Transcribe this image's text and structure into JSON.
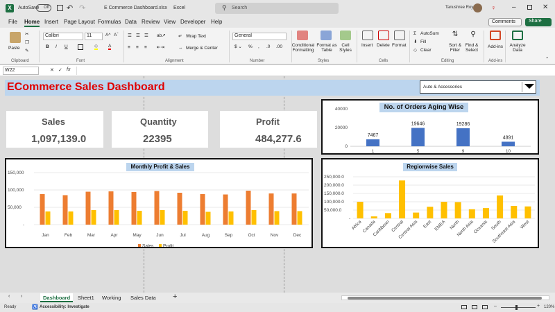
{
  "titlebar": {
    "autosave": "AutoSave",
    "autosave_state": "Off",
    "filename": "E Commerce Dashboard.xlsx",
    "app": "Excel",
    "search_placeholder": "Search",
    "user": "Tanushree Roy"
  },
  "menu": [
    "File",
    "Home",
    "Insert",
    "Page Layout",
    "Formulas",
    "Data",
    "Review",
    "View",
    "Developer",
    "Help"
  ],
  "menu_right": {
    "comments": "Comments",
    "share": "Share"
  },
  "ribbon": {
    "clipboard": {
      "paste": "Paste",
      "label": "Clipboard"
    },
    "font": {
      "name": "Calibri",
      "size": "11",
      "label": "Font"
    },
    "alignment": {
      "wrap": "Wrap Text",
      "merge": "Merge & Center",
      "label": "Alignment"
    },
    "number": {
      "format": "General",
      "label": "Number"
    },
    "styles": {
      "conditional": "Conditional Formatting",
      "table": "Format as Table",
      "cell": "Cell Styles",
      "label": "Styles"
    },
    "cells": {
      "insert": "Insert",
      "delete": "Delete",
      "format": "Format",
      "label": "Cells"
    },
    "editing": {
      "autosum": "AutoSum",
      "fill": "Fill",
      "clear": "Clear",
      "sort": "Sort & Filter",
      "find": "Find & Select",
      "label": "Editing"
    },
    "addins": {
      "addins": "Add-ins",
      "label": "Add-ins"
    },
    "analyze": {
      "label": "Analyze Data"
    }
  },
  "formula": {
    "namebox": "W22",
    "fx": "fx"
  },
  "dashboard": {
    "title": "ECommerce Sales Dashboard",
    "dropdown": "Auto & Accessories",
    "kpis": [
      {
        "label": "Sales",
        "value": "1,097,139.0"
      },
      {
        "label": "Quantity",
        "value": "22395"
      },
      {
        "label": "Profit",
        "value": "484,277.6"
      }
    ]
  },
  "chart_data": [
    {
      "type": "bar",
      "title": "No. of Orders Aging Wise",
      "categories": [
        "1",
        "5",
        "9",
        "10"
      ],
      "values": [
        7467,
        19646,
        19286,
        4891
      ],
      "yticks": [
        "40000",
        "20000",
        "0"
      ],
      "ylim": [
        0,
        40000
      ],
      "color": "#4472c4"
    },
    {
      "type": "bar",
      "title": "Monthly Profit & Sales",
      "categories": [
        "Jan",
        "Feb",
        "Mar",
        "Apr",
        "May",
        "Jun",
        "Jul",
        "Aug",
        "Sep",
        "Oct",
        "Nov",
        "Dec"
      ],
      "series": [
        {
          "name": "Sales",
          "values": [
            88000,
            85000,
            95000,
            96000,
            94000,
            97000,
            92000,
            88000,
            87000,
            98000,
            90000,
            90000
          ],
          "color": "#ed7d31"
        },
        {
          "name": "Profit",
          "values": [
            38000,
            38000,
            42000,
            42000,
            40000,
            42000,
            40000,
            37000,
            38000,
            42000,
            39000,
            39000
          ],
          "color": "#ffc000"
        }
      ],
      "yticks": [
        "150,000",
        "100,000",
        "50,000",
        "-"
      ],
      "ylim": [
        0,
        150000
      ]
    },
    {
      "type": "bar",
      "title": "Regionwise Sales",
      "categories": [
        "Africa",
        "Canada",
        "Caribbean",
        "Central",
        "Central Asia",
        "East",
        "EMEA",
        "North",
        "North Asia",
        "Oceania",
        "South",
        "Southeast Asia",
        "West"
      ],
      "values": [
        100000,
        12000,
        32000,
        228000,
        35000,
        70000,
        100000,
        98000,
        55000,
        62000,
        138000,
        75000,
        72000
      ],
      "yticks": [
        "250,000.0",
        "200,000.0",
        "150,000.0",
        "100,000.0",
        "50,000.0",
        "-"
      ],
      "ylim": [
        0,
        250000
      ],
      "color": "#ffc000"
    }
  ],
  "sheets": {
    "tabs": [
      "Dashboard",
      "Sheet1",
      "Working",
      "Sales Data"
    ],
    "active": "Dashboard"
  },
  "status": {
    "ready": "Ready",
    "accessibility": "Accessibility: Investigate",
    "zoom": "120%"
  }
}
